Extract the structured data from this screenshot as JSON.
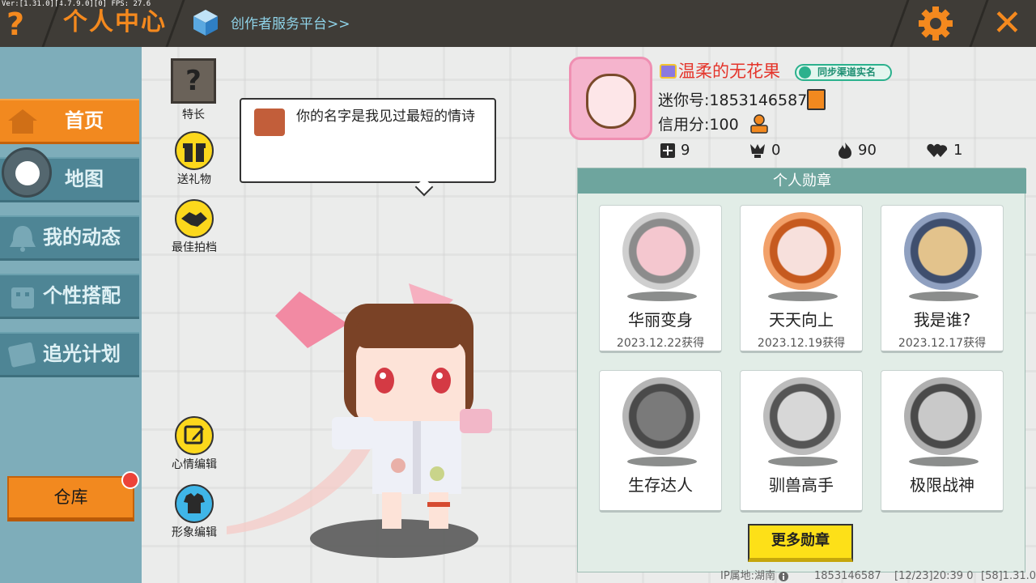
{
  "debug": {
    "version_text": "Ver:[1.31.0][4.7.9.0][0] FPS: 27.6"
  },
  "header": {
    "help_label": "?",
    "title": "个人中心",
    "creator_link": "创作者服务平台>>",
    "close_label": "✕"
  },
  "sidebar": {
    "items": [
      {
        "label": "首页",
        "icon": "house-icon",
        "active": true
      },
      {
        "label": "地图",
        "icon": "map-icon",
        "active": false
      },
      {
        "label": "我的动态",
        "icon": "bell-icon",
        "active": false
      },
      {
        "label": "个性搭配",
        "icon": "outfit-icon",
        "active": false
      },
      {
        "label": "追光计划",
        "icon": "light-plan-icon",
        "active": false
      }
    ],
    "storage_label": "仓库"
  },
  "actions": {
    "skill_label": "特长",
    "skill_icon_text": "?",
    "gift_label": "送礼物",
    "partner_label": "最佳拍档",
    "mood_label": "心情编辑",
    "look_label": "形象编辑"
  },
  "bubble": {
    "text": "你的名字是我见过最短的情诗"
  },
  "profile": {
    "name": "温柔的无花果",
    "sync_label": "同步渠道实名",
    "mini_id_label": "迷你号:1853146587",
    "credit_label": "信用分:100",
    "stats": [
      {
        "icon": "plus-square-icon",
        "value": "9"
      },
      {
        "icon": "trophy-icon",
        "value": "0"
      },
      {
        "icon": "flame-icon",
        "value": "90"
      },
      {
        "icon": "hearts-icon",
        "value": "1"
      }
    ]
  },
  "medals": {
    "title": "个人勋章",
    "items": [
      {
        "name": "华丽变身",
        "date": "2023.12.22获得",
        "icon": "transform-medal-icon",
        "color": "#c9c9c9"
      },
      {
        "name": "天天向上",
        "date": "2023.12.19获得",
        "icon": "calendar-medal-icon",
        "color": "#f2a16a"
      },
      {
        "name": "我是谁?",
        "date": "2023.12.17获得",
        "icon": "letter-medal-icon",
        "color": "#8fa0c0"
      },
      {
        "name": "生存达人",
        "date": "",
        "icon": "fire-medal-icon",
        "color": "#9a9a9a"
      },
      {
        "name": "驯兽高手",
        "date": "",
        "icon": "beast-medal-icon",
        "color": "#a3a3a3"
      },
      {
        "name": "极限战神",
        "date": "",
        "icon": "boss-medal-icon",
        "color": "#9d9d9d"
      }
    ],
    "more_label": "更多勋章"
  },
  "footer": {
    "ip_label": "IP属地:湖南",
    "uid": "1853146587",
    "timestamp": "[12/23]20:39 0",
    "build": "[58]1.31.0"
  },
  "colors": {
    "accent": "#f2891f",
    "sidebar": "#4e8595",
    "name_red": "#e4352b",
    "medal_header": "#6ea59e",
    "button_yellow": "#fde018"
  }
}
